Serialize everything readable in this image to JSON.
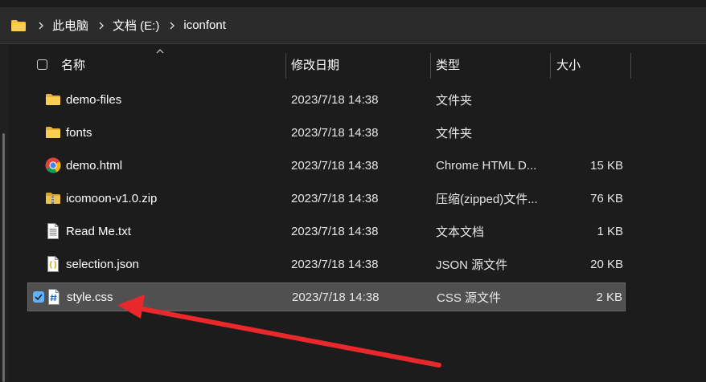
{
  "breadcrumb": {
    "items": [
      "此电脑",
      "文档 (E:)",
      "iconfont"
    ]
  },
  "columns": {
    "name": "名称",
    "modified": "修改日期",
    "type": "类型",
    "size": "大小"
  },
  "files": [
    {
      "name": "demo-files",
      "modified": "2023/7/18 14:38",
      "type": "文件夹",
      "size": "",
      "icon": "folder-icon"
    },
    {
      "name": "fonts",
      "modified": "2023/7/18 14:38",
      "type": "文件夹",
      "size": "",
      "icon": "folder-icon"
    },
    {
      "name": "demo.html",
      "modified": "2023/7/18 14:38",
      "type": "Chrome HTML D...",
      "size": "15 KB",
      "icon": "chrome-icon"
    },
    {
      "name": "icomoon-v1.0.zip",
      "modified": "2023/7/18 14:38",
      "type": "压缩(zipped)文件...",
      "size": "76 KB",
      "icon": "zip-folder-icon"
    },
    {
      "name": "Read Me.txt",
      "modified": "2023/7/18 14:38",
      "type": "文本文档",
      "size": "1 KB",
      "icon": "text-file-icon"
    },
    {
      "name": "selection.json",
      "modified": "2023/7/18 14:38",
      "type": "JSON 源文件",
      "size": "20 KB",
      "icon": "json-file-icon"
    },
    {
      "name": "style.css",
      "modified": "2023/7/18 14:38",
      "type": "CSS 源文件",
      "size": "2 KB",
      "icon": "css-file-icon",
      "selected": true
    }
  ],
  "colors": {
    "background": "#1c1c1c",
    "selected_row": "#505050",
    "checkbox_accent": "#5cb3ff",
    "folder": "#f3c13a",
    "arrow": "#e8282a"
  }
}
